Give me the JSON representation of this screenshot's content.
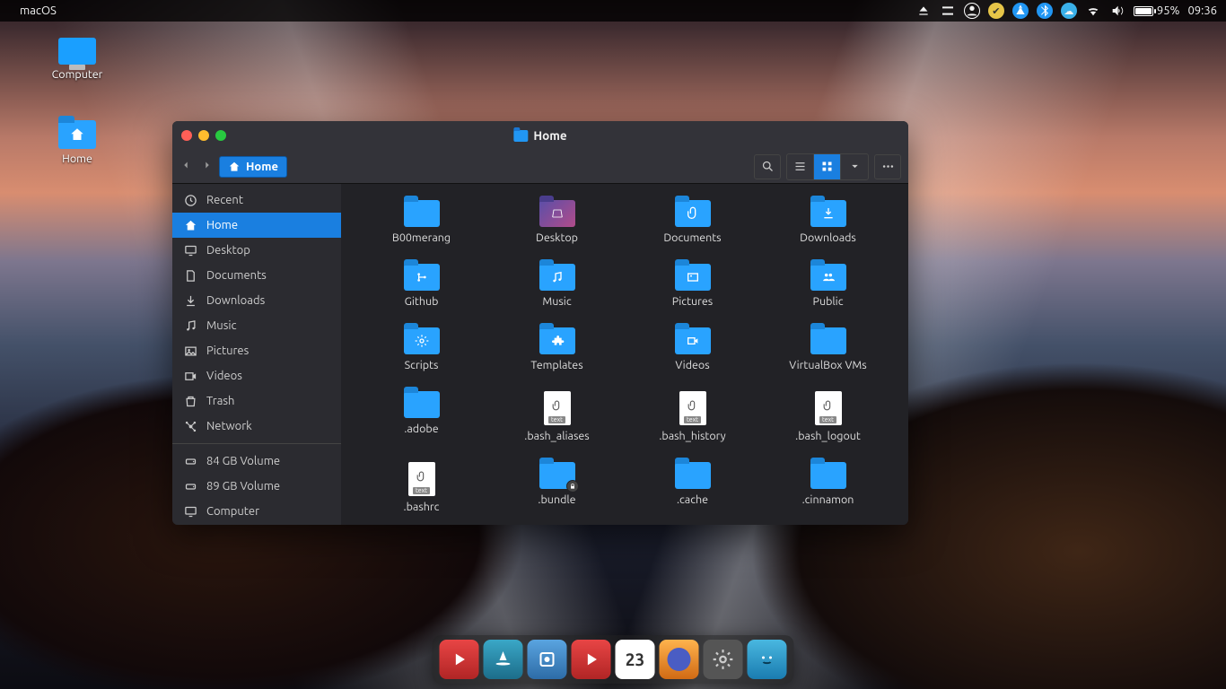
{
  "menubar": {
    "app_name": "macOS",
    "battery": "95%",
    "time": "09:36"
  },
  "desktop_icons": [
    {
      "label": "Computer",
      "kind": "monitor"
    },
    {
      "label": "Home",
      "kind": "home-folder"
    }
  ],
  "window": {
    "title": "Home",
    "path_label": "Home",
    "sidebar": {
      "places": [
        {
          "label": "Recent",
          "icon": "clock"
        },
        {
          "label": "Home",
          "icon": "home",
          "active": true
        },
        {
          "label": "Desktop",
          "icon": "monitor"
        },
        {
          "label": "Documents",
          "icon": "document"
        },
        {
          "label": "Downloads",
          "icon": "download"
        },
        {
          "label": "Music",
          "icon": "music"
        },
        {
          "label": "Pictures",
          "icon": "picture"
        },
        {
          "label": "Videos",
          "icon": "video"
        },
        {
          "label": "Trash",
          "icon": "trash"
        },
        {
          "label": "Network",
          "icon": "network"
        }
      ],
      "devices": [
        {
          "label": "84 GB Volume",
          "icon": "disk"
        },
        {
          "label": "89 GB Volume",
          "icon": "disk"
        },
        {
          "label": "Computer",
          "icon": "monitor"
        }
      ]
    },
    "items": [
      {
        "name": "B00merang",
        "type": "folder"
      },
      {
        "name": "Desktop",
        "type": "folder",
        "glyph": "desktop",
        "gradient": true
      },
      {
        "name": "Documents",
        "type": "folder",
        "glyph": "clip"
      },
      {
        "name": "Downloads",
        "type": "folder",
        "glyph": "download"
      },
      {
        "name": "Github",
        "type": "folder",
        "glyph": "git"
      },
      {
        "name": "Music",
        "type": "folder",
        "glyph": "music"
      },
      {
        "name": "Pictures",
        "type": "folder",
        "glyph": "picture"
      },
      {
        "name": "Public",
        "type": "folder",
        "glyph": "people"
      },
      {
        "name": "Scripts",
        "type": "folder",
        "glyph": "gear"
      },
      {
        "name": "Templates",
        "type": "folder",
        "glyph": "puzzle"
      },
      {
        "name": "Videos",
        "type": "folder",
        "glyph": "video"
      },
      {
        "name": "VirtualBox VMs",
        "type": "folder"
      },
      {
        "name": ".adobe",
        "type": "folder"
      },
      {
        "name": ".bash_aliases",
        "type": "textfile"
      },
      {
        "name": ".bash_history",
        "type": "textfile"
      },
      {
        "name": ".bash_logout",
        "type": "textfile"
      },
      {
        "name": ".bashrc",
        "type": "textfile"
      },
      {
        "name": ".bundle",
        "type": "folder",
        "locked": true
      },
      {
        "name": ".cache",
        "type": "folder"
      },
      {
        "name": ".cinnamon",
        "type": "folder"
      }
    ]
  },
  "dock": [
    {
      "name": "media1",
      "style": "d-red",
      "glyph": "play"
    },
    {
      "name": "wizard",
      "style": "d-teal",
      "glyph": "hat"
    },
    {
      "name": "mail",
      "style": "d-blue",
      "glyph": "stamp"
    },
    {
      "name": "media2",
      "style": "d-red",
      "glyph": "play"
    },
    {
      "name": "calendar",
      "style": "d-cal",
      "day": "23"
    },
    {
      "name": "firefox",
      "style": "d-ff",
      "glyph": ""
    },
    {
      "name": "settings",
      "style": "d-gear",
      "glyph": "gear"
    },
    {
      "name": "users",
      "style": "d-happy",
      "glyph": "face"
    }
  ]
}
